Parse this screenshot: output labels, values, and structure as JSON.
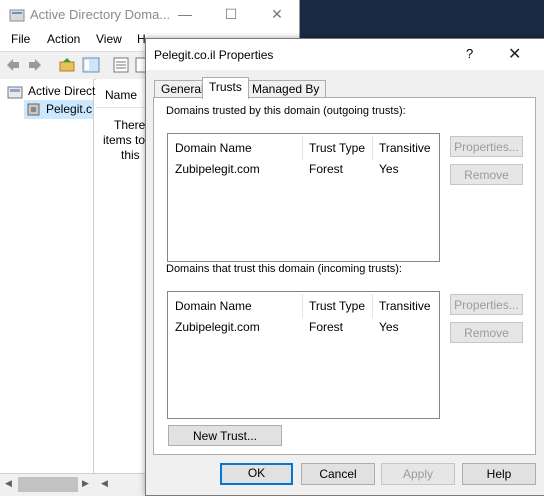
{
  "bg_window": {
    "title": "Active Directory Doma...",
    "menu": [
      "File",
      "Action",
      "View",
      "H"
    ],
    "tree": {
      "root": "Active Direct",
      "child": "Pelegit.c"
    },
    "list": {
      "column": "Name",
      "empty_lines": [
        "There",
        "items to",
        "this"
      ]
    }
  },
  "dialog": {
    "title": "Pelegit.co.il Properties",
    "help_glyph": "?",
    "tabs": [
      "General",
      "Trusts",
      "Managed By"
    ],
    "outgoing": {
      "label": "Domains trusted by this domain (outgoing trusts):",
      "columns": [
        "Domain Name",
        "Trust Type",
        "Transitive"
      ],
      "rows": [
        {
          "domain": "Zubipelegit.com",
          "type": "Forest",
          "transitive": "Yes"
        }
      ],
      "properties_btn": "Properties...",
      "remove_btn": "Remove"
    },
    "incoming": {
      "label": "Domains that trust this domain (incoming trusts):",
      "columns": [
        "Domain Name",
        "Trust Type",
        "Transitive"
      ],
      "rows": [
        {
          "domain": "Zubipelegit.com",
          "type": "Forest",
          "transitive": "Yes"
        }
      ],
      "properties_btn": "Properties...",
      "remove_btn": "Remove"
    },
    "new_trust_btn": "New Trust...",
    "buttons": {
      "ok": "OK",
      "cancel": "Cancel",
      "apply": "Apply",
      "help": "Help"
    }
  },
  "colors": {
    "accent": "#0078d7",
    "desktop": "#1b2a44"
  }
}
